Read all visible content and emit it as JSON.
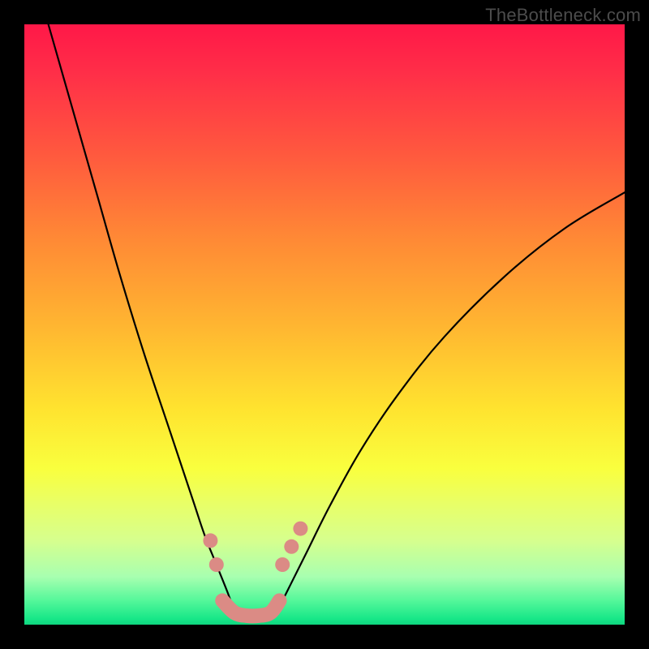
{
  "watermark": "TheBottleneck.com",
  "chart_data": {
    "type": "line",
    "title": "",
    "xlabel": "",
    "ylabel": "",
    "xlim": [
      0,
      100
    ],
    "ylim": [
      0,
      100
    ],
    "grid": false,
    "legend": false,
    "note": "Bottleneck-style V-curve over red-to-green gradient; numeric values are estimated from pixel positions (no axis ticks in source).",
    "series": [
      {
        "name": "left-branch",
        "x": [
          4,
          8,
          12,
          16,
          20,
          24,
          28,
          30,
          32,
          34,
          35
        ],
        "y": [
          100,
          86,
          72,
          58,
          45,
          33,
          21,
          15,
          10,
          5,
          2
        ]
      },
      {
        "name": "right-branch",
        "x": [
          42,
          44,
          47,
          51,
          56,
          62,
          70,
          80,
          90,
          100
        ],
        "y": [
          2,
          6,
          12,
          20,
          29,
          38,
          48,
          58,
          66,
          72
        ]
      },
      {
        "name": "valley-floor",
        "x": [
          35,
          37,
          39,
          41,
          42
        ],
        "y": [
          2,
          1,
          1,
          1,
          2
        ]
      }
    ],
    "markers": {
      "name": "highlight-points",
      "color": "#db8b85",
      "points": [
        {
          "x": 31,
          "y": 14
        },
        {
          "x": 32,
          "y": 10
        },
        {
          "x": 43,
          "y": 10
        },
        {
          "x": 44.5,
          "y": 13
        },
        {
          "x": 46,
          "y": 16
        }
      ]
    },
    "worm_segment": {
      "name": "valley-worm",
      "color": "#db8b85",
      "x": [
        33,
        35,
        37,
        39,
        41,
        42.5
      ],
      "y": [
        4,
        2,
        1.5,
        1.5,
        2,
        4
      ]
    }
  }
}
